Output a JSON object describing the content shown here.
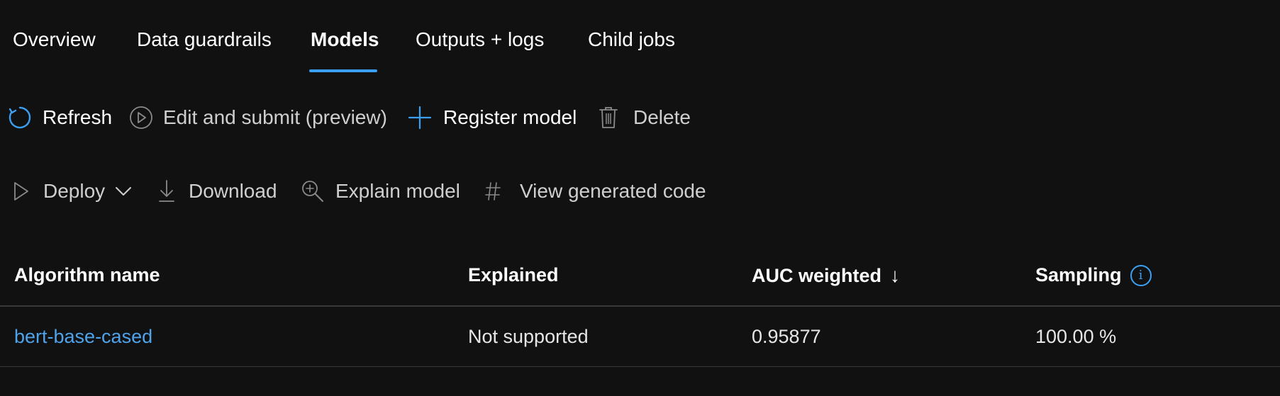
{
  "tabs": [
    {
      "label": "Overview",
      "active": false
    },
    {
      "label": "Data guardrails",
      "active": false
    },
    {
      "label": "Models",
      "active": true
    },
    {
      "label": "Outputs + logs",
      "active": false
    },
    {
      "label": "Child jobs",
      "active": false
    }
  ],
  "toolbar1": {
    "refresh": {
      "label": "Refresh",
      "icon": "refresh-icon",
      "enabled": true
    },
    "edit_submit": {
      "label": "Edit and submit (preview)",
      "icon": "play-circle-icon",
      "enabled": false
    },
    "register_model": {
      "label": "Register model",
      "icon": "plus-icon",
      "enabled": true
    },
    "delete": {
      "label": "Delete",
      "icon": "trash-icon",
      "enabled": false
    }
  },
  "toolbar2": {
    "deploy": {
      "label": "Deploy",
      "icon": "play-outline-icon",
      "dropdown_icon": "chevron-down-icon",
      "enabled": false
    },
    "download": {
      "label": "Download",
      "icon": "download-icon",
      "enabled": false
    },
    "explain_model": {
      "label": "Explain model",
      "icon": "zoom-in-icon",
      "enabled": false
    },
    "view_code": {
      "label": "View generated code",
      "icon": "hash-icon",
      "enabled": false
    }
  },
  "table": {
    "columns": [
      {
        "label": "Algorithm name"
      },
      {
        "label": "Explained"
      },
      {
        "label": "AUC weighted",
        "sort_indicator": "↓"
      },
      {
        "label": "Sampling",
        "info_icon": "info-icon",
        "info_glyph": "i"
      }
    ],
    "rows": [
      {
        "algorithm_name": "bert-base-cased",
        "explained": "Not supported",
        "auc_weighted": "0.95877",
        "sampling": "100.00 %"
      }
    ]
  },
  "colors": {
    "background": "#111111",
    "accent": "#3aa0f3",
    "link": "#4fa3ea",
    "disabled_icon": "#8a8a8a",
    "separator": "#3a3a3a"
  }
}
